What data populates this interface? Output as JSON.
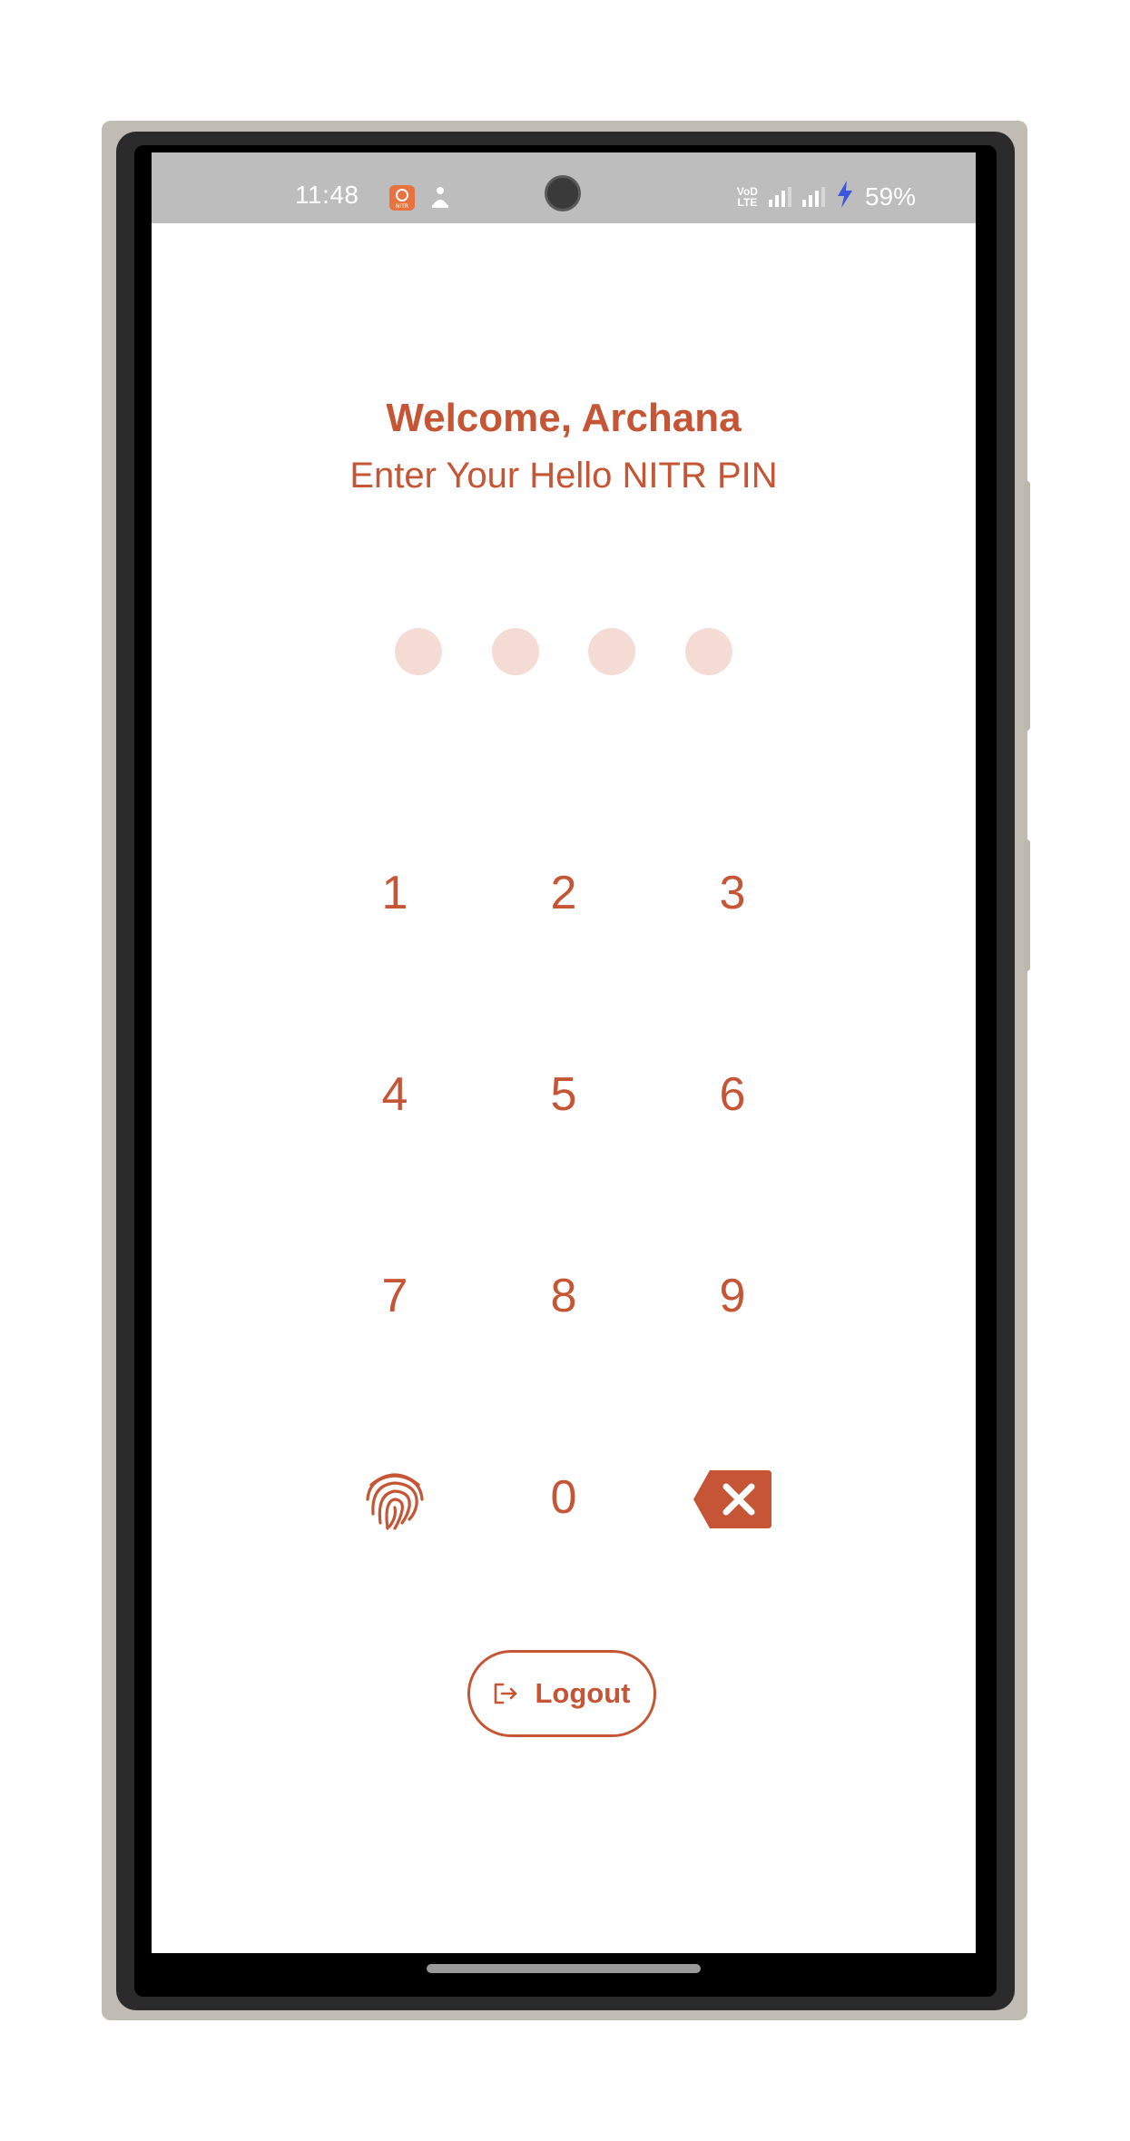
{
  "status_bar": {
    "time": "11:48",
    "app_icon_label": "NITR",
    "volte_line1": "VoD",
    "volte_line2": "LTE",
    "battery": "59%",
    "icons": [
      "app-notification-icon",
      "accessibility-icon",
      "volte-icon",
      "signal-icon",
      "signal-icon",
      "charging-icon"
    ]
  },
  "header": {
    "welcome": "Welcome, Archana",
    "subtitle": "Enter Your Hello NITR PIN"
  },
  "pin": {
    "length": 4,
    "entered": 0
  },
  "keypad": {
    "keys": [
      "1",
      "2",
      "3",
      "4",
      "5",
      "6",
      "7",
      "8",
      "9",
      "0"
    ],
    "left_action_icon": "fingerprint-icon",
    "right_action_icon": "backspace-icon"
  },
  "logout": {
    "label": "Logout",
    "icon": "logout-icon"
  },
  "colors": {
    "accent": "#c55535",
    "pin_dot_empty": "#f4dcd4",
    "status_bar": "#bdbdbd",
    "charging": "#3b55e0"
  }
}
